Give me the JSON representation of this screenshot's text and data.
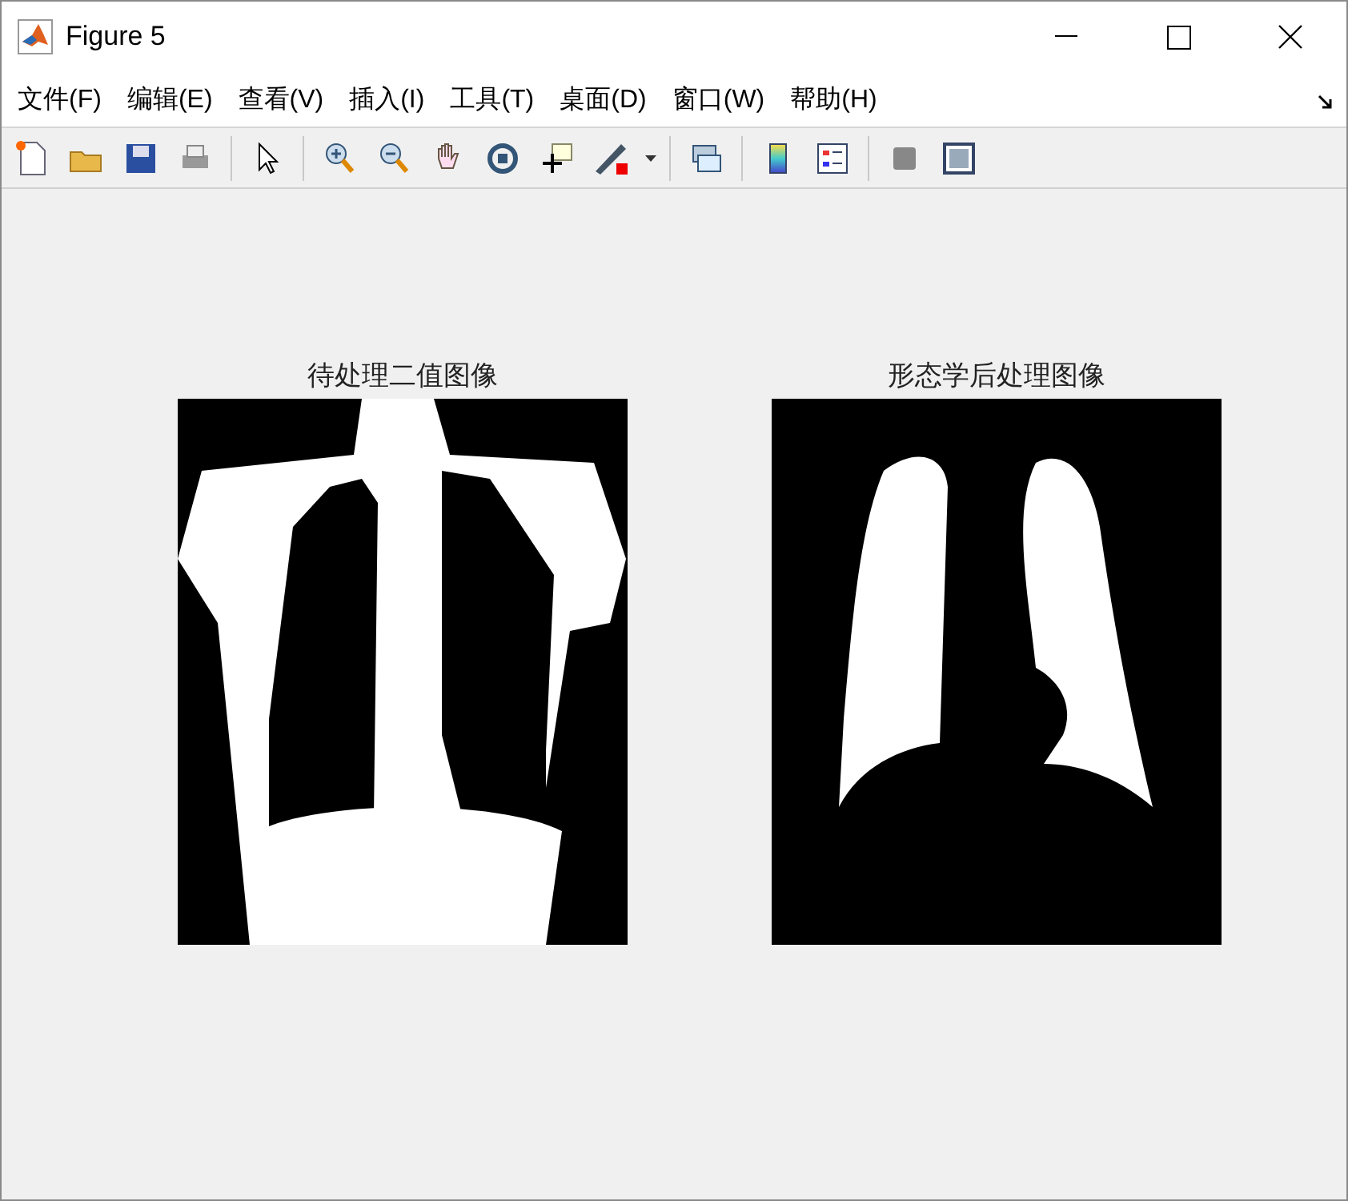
{
  "window": {
    "title": "Figure 5"
  },
  "menu": [
    {
      "label": "文件(F)"
    },
    {
      "label": "编辑(E)"
    },
    {
      "label": "查看(V)"
    },
    {
      "label": "插入(I)"
    },
    {
      "label": "工具(T)"
    },
    {
      "label": "桌面(D)"
    },
    {
      "label": "窗口(W)"
    },
    {
      "label": "帮助(H)"
    }
  ],
  "axes": [
    {
      "title": "待处理二值图像",
      "kind": "binary"
    },
    {
      "title": "形态学后处理图像",
      "kind": "mask"
    }
  ]
}
